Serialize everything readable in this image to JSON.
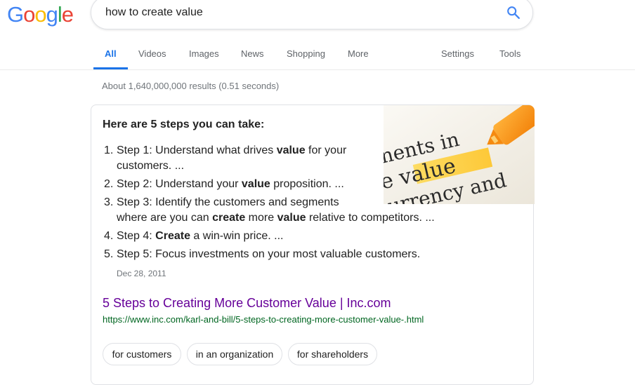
{
  "logo": {
    "text": "Google",
    "letters": [
      "G",
      "o",
      "o",
      "g",
      "l",
      "e"
    ],
    "colors": [
      "#4285F4",
      "#EA4335",
      "#FBBC05",
      "#4285F4",
      "#34A853",
      "#EA4335"
    ]
  },
  "search": {
    "query": "how to create value",
    "icon": "search-icon",
    "icon_color": "#4285F4"
  },
  "tabs": {
    "items": [
      {
        "label": "All",
        "active": true
      },
      {
        "label": "Videos",
        "active": false
      },
      {
        "label": "Images",
        "active": false
      },
      {
        "label": "News",
        "active": false
      },
      {
        "label": "Shopping",
        "active": false
      },
      {
        "label": "More",
        "active": false
      }
    ],
    "settings_label": "Settings",
    "tools_label": "Tools"
  },
  "result_stats": "About 1,640,000,000 results (0.51 seconds)",
  "snippet": {
    "heading": "Here are 5 steps you can take:",
    "image_words": [
      "nents in",
      "e value",
      "urrency and"
    ],
    "steps": [
      {
        "num": "1.",
        "line1": [
          "Step 1: Understand what drives ",
          "value",
          " for your"
        ],
        "line2": [
          "customers. ..."
        ]
      },
      {
        "num": "2.",
        "line1": [
          "Step 2: Understand your ",
          "value",
          " proposition. ..."
        ]
      },
      {
        "num": "3.",
        "line1": [
          "Step 3: Identify the customers and segments"
        ],
        "line2": [
          "where are you can ",
          "create",
          " more ",
          "value",
          " relative to competitors. ..."
        ]
      },
      {
        "num": "4.",
        "line1": [
          "Step 4: ",
          "Create",
          " a win-win price. ..."
        ]
      },
      {
        "num": "5.",
        "line1": [
          "Step 5: Focus investments on your most valuable customers."
        ]
      }
    ],
    "date": "Dec 28, 2011",
    "title": "5 Steps to Creating More Customer Value | Inc.com",
    "url": "https://www.inc.com/karl-and-bill/5-steps-to-creating-more-customer-value-.html"
  },
  "chips": [
    "for customers",
    "in an organization",
    "for shareholders"
  ],
  "colors": {
    "tab_active": "#1a73e8",
    "link_visited": "#660099",
    "url_green": "#006621"
  }
}
